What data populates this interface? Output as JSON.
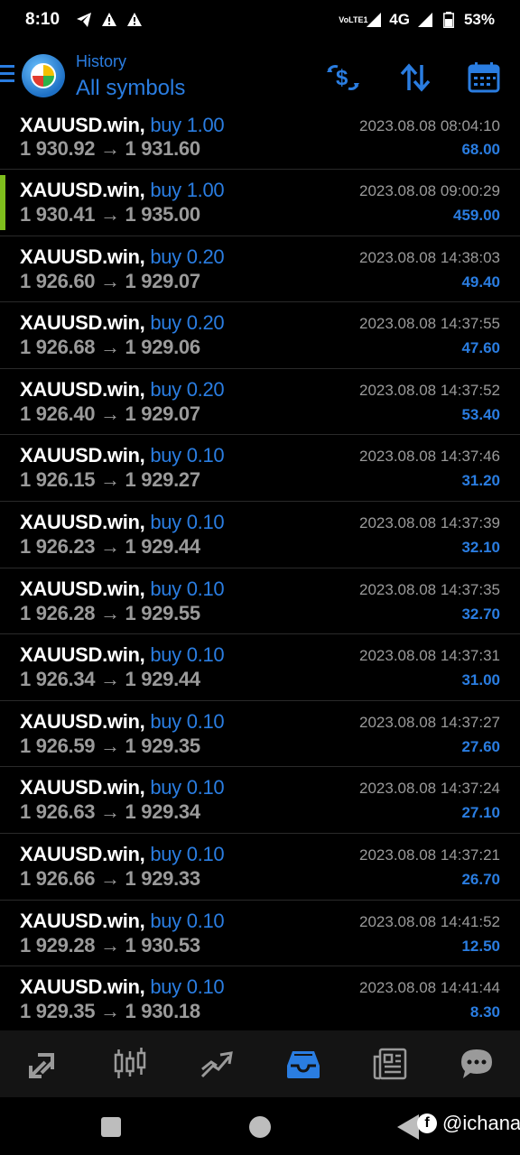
{
  "status_bar": {
    "time": "8:10",
    "volte": "VoLTE1",
    "network": "4G",
    "battery": "53%"
  },
  "header": {
    "subtitle": "History",
    "title": "All symbols",
    "icons": [
      "hamburger-icon",
      "mt-logo-icon",
      "currency-exchange-icon",
      "sort-icon",
      "calendar-icon"
    ]
  },
  "colors": {
    "accent_blue": "#2a7de1",
    "selected_bar": "#7fbf1d",
    "background": "#000000",
    "muted_text": "#9a9a9a"
  },
  "trades": [
    {
      "symbol": "XAUUSD.win,",
      "side": "buy 1.00",
      "prices": "1 930.92 → 1 931.60",
      "time": "2023.08.08 08:04:10",
      "profit": "68.00"
    },
    {
      "symbol": "XAUUSD.win,",
      "side": "buy 1.00",
      "prices": "1 930.41 → 1 935.00",
      "time": "2023.08.08 09:00:29",
      "profit": "459.00",
      "selected": true
    },
    {
      "symbol": "XAUUSD.win,",
      "side": "buy 0.20",
      "prices": "1 926.60 → 1 929.07",
      "time": "2023.08.08 14:38:03",
      "profit": "49.40"
    },
    {
      "symbol": "XAUUSD.win,",
      "side": "buy 0.20",
      "prices": "1 926.68 → 1 929.06",
      "time": "2023.08.08 14:37:55",
      "profit": "47.60"
    },
    {
      "symbol": "XAUUSD.win,",
      "side": "buy 0.20",
      "prices": "1 926.40 → 1 929.07",
      "time": "2023.08.08 14:37:52",
      "profit": "53.40"
    },
    {
      "symbol": "XAUUSD.win,",
      "side": "buy 0.10",
      "prices": "1 926.15 → 1 929.27",
      "time": "2023.08.08 14:37:46",
      "profit": "31.20"
    },
    {
      "symbol": "XAUUSD.win,",
      "side": "buy 0.10",
      "prices": "1 926.23 → 1 929.44",
      "time": "2023.08.08 14:37:39",
      "profit": "32.10"
    },
    {
      "symbol": "XAUUSD.win,",
      "side": "buy 0.10",
      "prices": "1 926.28 → 1 929.55",
      "time": "2023.08.08 14:37:35",
      "profit": "32.70"
    },
    {
      "symbol": "XAUUSD.win,",
      "side": "buy 0.10",
      "prices": "1 926.34 → 1 929.44",
      "time": "2023.08.08 14:37:31",
      "profit": "31.00"
    },
    {
      "symbol": "XAUUSD.win,",
      "side": "buy 0.10",
      "prices": "1 926.59 → 1 929.35",
      "time": "2023.08.08 14:37:27",
      "profit": "27.60"
    },
    {
      "symbol": "XAUUSD.win,",
      "side": "buy 0.10",
      "prices": "1 926.63 → 1 929.34",
      "time": "2023.08.08 14:37:24",
      "profit": "27.10"
    },
    {
      "symbol": "XAUUSD.win,",
      "side": "buy 0.10",
      "prices": "1 926.66 → 1 929.33",
      "time": "2023.08.08 14:37:21",
      "profit": "26.70"
    },
    {
      "symbol": "XAUUSD.win,",
      "side": "buy 0.10",
      "prices": "1 929.28 → 1 930.53",
      "time": "2023.08.08 14:41:52",
      "profit": "12.50"
    },
    {
      "symbol": "XAUUSD.win,",
      "side": "buy 0.10",
      "prices": "1 929.35 → 1 930.18",
      "time": "2023.08.08 14:41:44",
      "profit": "8.30"
    }
  ],
  "bottom_nav": {
    "items": [
      "quotes-icon",
      "chart-icon",
      "trade-icon",
      "history-icon",
      "news-icon",
      "chat-icon"
    ],
    "active": "history-icon"
  },
  "watermark": {
    "text": "@ichana"
  }
}
